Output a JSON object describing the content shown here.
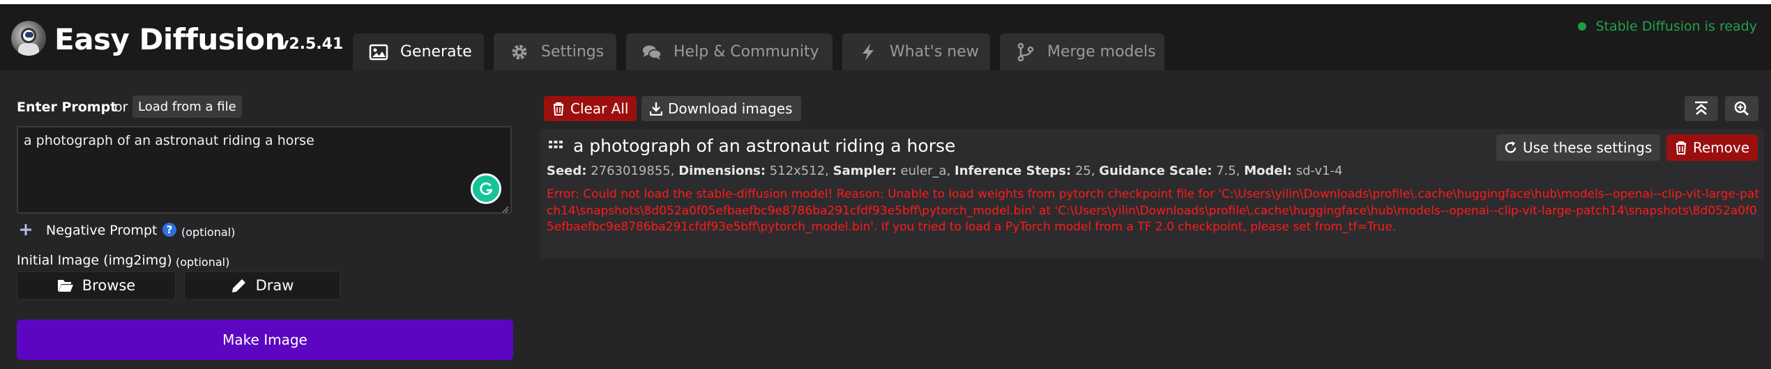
{
  "header": {
    "title": "Easy Diffusion",
    "version": "v2.5.41",
    "status": "Stable Diffusion is ready",
    "status_color": "#24a148",
    "tabs": [
      {
        "label": "Generate",
        "icon": "image-icon",
        "active": true
      },
      {
        "label": "Settings",
        "icon": "gear-icon",
        "active": false
      },
      {
        "label": "Help & Community",
        "icon": "comments-icon",
        "active": false
      },
      {
        "label": "What's new",
        "icon": "bolt-icon",
        "active": false
      },
      {
        "label": "Merge models",
        "icon": "code-fork-icon",
        "active": false
      }
    ]
  },
  "left": {
    "prompt_label": "Enter Prompt",
    "or_text": "or",
    "load_file_label": "Load from a file",
    "prompt_value": "a photograph of an astronaut riding a horse",
    "negative_label": "Negative Prompt",
    "negative_optional": "(optional)",
    "init_image_label": "Initial Image (img2img)",
    "init_image_optional": "(optional)",
    "browse_label": "Browse",
    "draw_label": "Draw",
    "make_image_label": "Make Image",
    "make_image_color": "#5c06c2"
  },
  "right": {
    "clear_all_label": "Clear All",
    "download_label": "Download images",
    "task": {
      "prompt": "a photograph of an astronaut riding a horse",
      "use_settings_label": "Use these settings",
      "remove_label": "Remove",
      "meta": {
        "seed_key": "Seed:",
        "seed": "2763019855",
        "dimensions_key": "Dimensions:",
        "dimensions": "512x512",
        "sampler_key": "Sampler:",
        "sampler": "euler_a",
        "steps_key": "Inference Steps:",
        "steps": "25",
        "guidance_key": "Guidance Scale:",
        "guidance": "7.5",
        "model_key": "Model:",
        "model": "sd-v1-4"
      },
      "error": "Error: Could not load the stable-diffusion model! Reason: Unable to load weights from pytorch checkpoint file for 'C:\\Users\\yilin\\Downloads\\profile\\.cache\\huggingface\\hub\\models--openai--clip-vit-large-patch14\\snapshots\\8d052a0f05efbaefbc9e8786ba291cfdf93e5bff\\pytorch_model.bin' at 'C:\\Users\\yilin\\Downloads\\profile\\.cache\\huggingface\\hub\\models--openai--clip-vit-large-patch14\\snapshots\\8d052a0f05efbaefbc9e8786ba291cfdf93e5bff\\pytorch_model.bin'. If you tried to load a PyTorch model from a TF 2.0 checkpoint, please set from_tf=True.",
      "error_color": "#ff1a1a"
    }
  }
}
